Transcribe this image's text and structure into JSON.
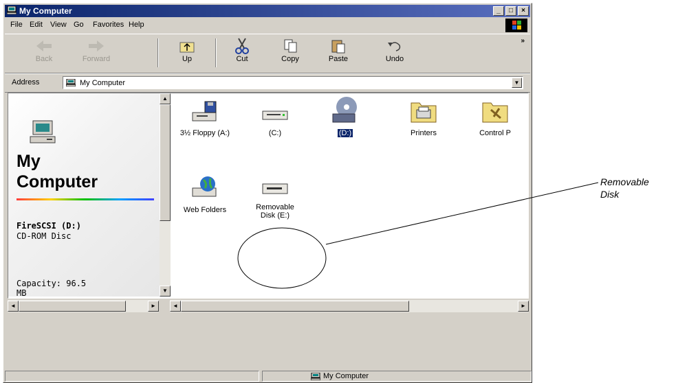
{
  "window": {
    "title": "My Computer"
  },
  "menu": [
    "File",
    "Edit",
    "View",
    "Go",
    "Favorites",
    "Help"
  ],
  "toolbar": [
    {
      "label": "Back",
      "icon": "back-arrow-icon",
      "enabled": false
    },
    {
      "label": "Forward",
      "icon": "forward-arrow-icon",
      "enabled": false
    },
    {
      "label": "Up",
      "icon": "up-folder-icon",
      "enabled": true
    },
    {
      "label": "Cut",
      "icon": "scissors-icon",
      "enabled": true
    },
    {
      "label": "Copy",
      "icon": "copy-icon",
      "enabled": true
    },
    {
      "label": "Paste",
      "icon": "paste-icon",
      "enabled": true
    },
    {
      "label": "Undo",
      "icon": "undo-icon",
      "enabled": true
    }
  ],
  "toolbar_more": "»",
  "address": {
    "label": "Address",
    "value": "My Computer"
  },
  "left_panel": {
    "title_line1": "My",
    "title_line2": "Computer",
    "selected_name": "FireSCSI (D:)",
    "selected_type": "CD-ROM Disc",
    "capacity": "Capacity: 96.5 MB"
  },
  "items": [
    {
      "label": "3½ Floppy (A:)",
      "icon": "floppy-drive-icon"
    },
    {
      "label": "(C:)",
      "icon": "hard-drive-icon"
    },
    {
      "label": "(D:)",
      "icon": "cd-drive-icon",
      "selected": true
    },
    {
      "label": "Printers",
      "icon": "printers-folder-icon"
    },
    {
      "label": "Control P",
      "icon": "control-panel-icon"
    },
    {
      "label": "Web Folders",
      "icon": "web-folders-icon"
    },
    {
      "label": "Removable Disk (E:)",
      "icon": "removable-disk-icon"
    }
  ],
  "status": {
    "text": "My Computer"
  },
  "callout": {
    "line1": "Removable",
    "line2": "Disk"
  },
  "colors": {
    "title_bar": "#0a246a",
    "face": "#d4d0c8",
    "selection": "#0a246a"
  }
}
